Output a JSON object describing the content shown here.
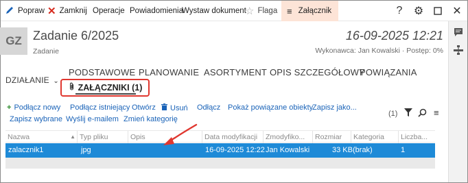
{
  "toolbar": {
    "popraw": "Popraw",
    "zamknij": "Zamknij",
    "operacje": "Operacje",
    "powiadomienia": "Powiadomienia",
    "wystaw": "Wystaw dokument",
    "flaga": "Flaga",
    "zalacznik": "Załącznik",
    "help_icon": "help-icon",
    "settings_icon": "gear-icon",
    "maximize_icon": "maximize-icon",
    "close_icon": "close-icon",
    "colors": {
      "edit": "#1a63b8",
      "close_x": "#d62a1e",
      "active_bg": "#fde4d7"
    }
  },
  "header": {
    "avatar": "GZ",
    "title": "Zadanie 6/2025",
    "subtitle": "Zadanie",
    "datetime": "16-09-2025 12:21",
    "meta": "Wykonawca: Jan Kowalski · Postęp: 0%"
  },
  "nav": {
    "dzialanie": "DZIAŁANIE",
    "tabs": [
      "PODSTAWOWE",
      "PLANOWANIE",
      "ASORTYMENT",
      "OPIS SZCZEGÓŁOWY",
      "POWIĄZANIA"
    ],
    "active_tab": "ZAŁĄCZNIKI (1)"
  },
  "actions": {
    "row1": [
      "Podłącz nowy",
      "Podłącz istniejący",
      "Otwórz",
      "Usuń",
      "Odłącz",
      "Pokaż powiązane obiekty",
      "Zapisz jako..."
    ],
    "row2": [
      "Zapisz wybrane",
      "Wyślij e-mailem",
      "Zmień kategorię"
    ],
    "count": "(1)",
    "accent": "#1a63b8"
  },
  "grid": {
    "columns": [
      "Nazwa",
      "Typ pliku",
      "Opis",
      "Data modyfikacji",
      "Zmodyfiko...",
      "Rozmiar",
      "Kategoria",
      "Liczba..."
    ],
    "rows": [
      {
        "nazwa": "zalacznik1",
        "typ": "jpg",
        "opis": "",
        "data": "16-09-2025 12:22",
        "zmodyfikowal": "Jan Kowalski",
        "rozmiar": "33 KB",
        "kategoria": "(brak)",
        "liczba": "1"
      }
    ],
    "selected_color": "#1e8ad7"
  }
}
